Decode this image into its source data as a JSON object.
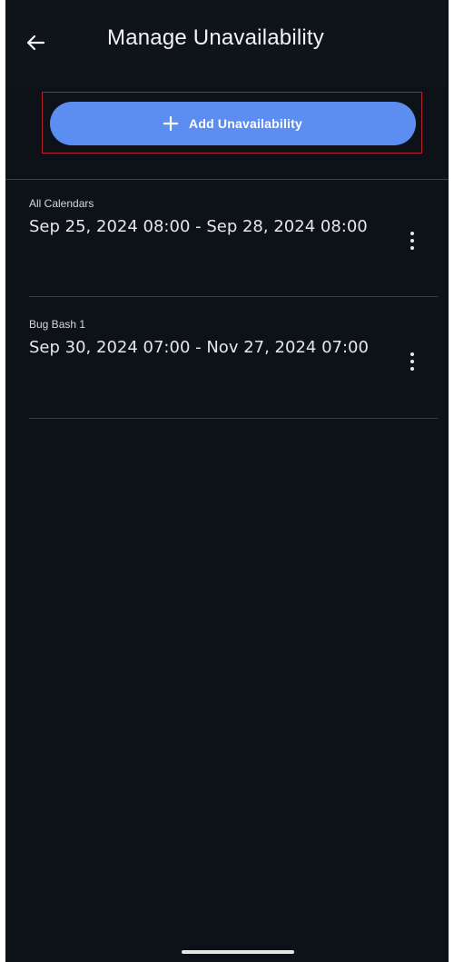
{
  "header": {
    "title": "Manage Unavailability",
    "back_icon": "arrow-left-icon"
  },
  "add_button": {
    "label": "Add Unavailability",
    "icon": "plus-icon"
  },
  "items": [
    {
      "calendar": "All Calendars",
      "range": "Sep 25, 2024 08:00 - Sep 28, 2024 08:00"
    },
    {
      "calendar": "Bug Bash 1",
      "range": "Sep 30, 2024 07:00 - Nov 27, 2024 07:00"
    }
  ],
  "colors": {
    "background": "#0d1118",
    "accent": "#5b8ef0",
    "highlight_border": "#b3232d",
    "text": "#e8e9ec"
  }
}
